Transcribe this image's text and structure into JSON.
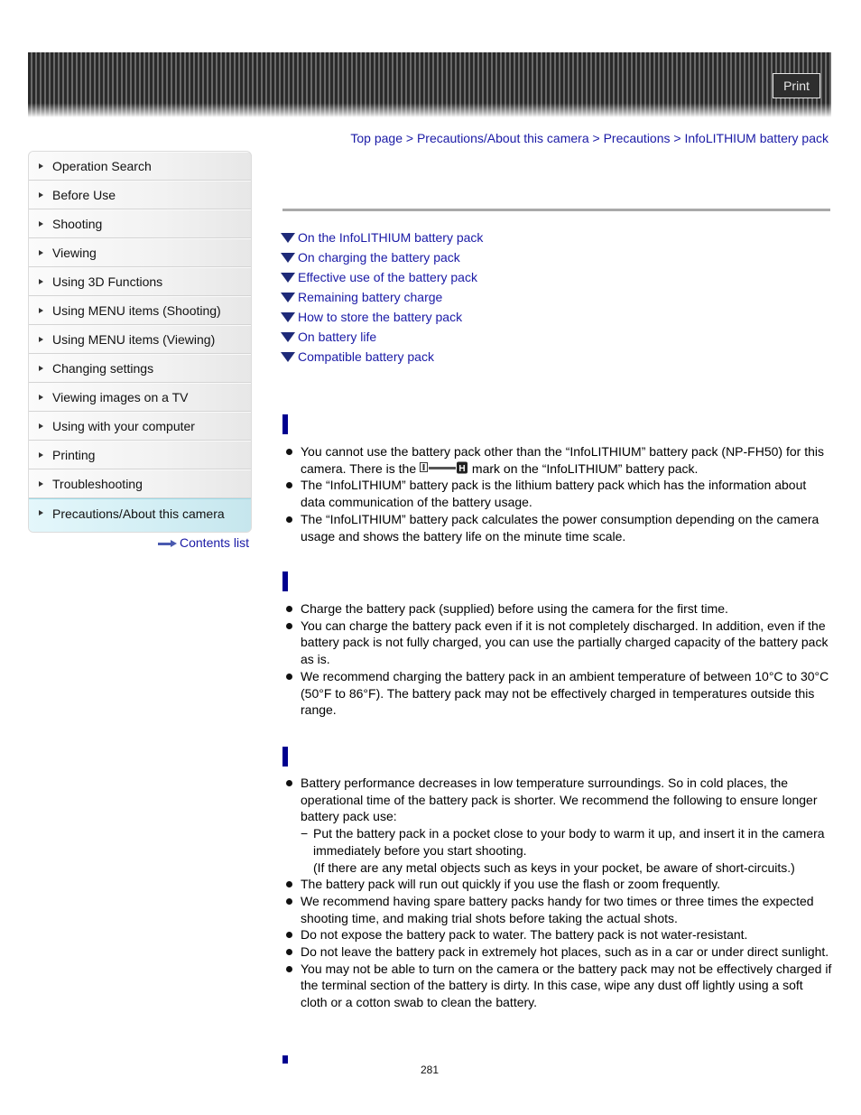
{
  "header": {
    "print_label": "Print"
  },
  "sidebar": {
    "items": [
      {
        "label": "Operation Search"
      },
      {
        "label": "Before Use"
      },
      {
        "label": "Shooting"
      },
      {
        "label": "Viewing"
      },
      {
        "label": "Using 3D Functions"
      },
      {
        "label": "Using MENU items (Shooting)"
      },
      {
        "label": "Using MENU items (Viewing)"
      },
      {
        "label": "Changing settings"
      },
      {
        "label": "Viewing images on a TV"
      },
      {
        "label": "Using with your computer"
      },
      {
        "label": "Printing"
      },
      {
        "label": "Troubleshooting"
      },
      {
        "label": "Precautions/About this camera",
        "active": true
      }
    ],
    "contents_link": "Contents list"
  },
  "breadcrumb": {
    "items": [
      "Top page",
      "Precautions/About this camera",
      "Precautions",
      "InfoLITHIUM battery pack"
    ],
    "separator": ">"
  },
  "toc": [
    "On the InfoLITHIUM battery pack",
    "On charging the battery pack",
    "Effective use of the battery pack",
    "Remaining battery charge",
    "How to store the battery pack",
    "On battery life",
    "Compatible battery pack"
  ],
  "sections": {
    "infolithium": {
      "b1_pre": "You cannot use the battery pack other than the “InfoLITHIUM” battery pack (NP-FH50) for this camera. There is the ",
      "b1_icon": "infolithium-h-mark-icon",
      "b1_post": " mark on the “InfoLITHIUM” battery pack.",
      "b2": "The “InfoLITHIUM” battery pack is the lithium battery pack which has the information about data communication of the battery usage.",
      "b3": "The “InfoLITHIUM” battery pack calculates the power consumption depending on the camera usage and shows the battery life on the minute time scale."
    },
    "charging": {
      "b1": "Charge the battery pack (supplied) before using the camera for the first time.",
      "b2": "You can charge the battery pack even if it is not completely discharged. In addition, even if the battery pack is not fully charged, you can use the partially charged capacity of the battery pack as is.",
      "b3": "We recommend charging the battery pack in an ambient temperature of between 10°C to 30°C (50°F to 86°F). The battery pack may not be effectively charged in temperatures outside this range."
    },
    "effective_use": {
      "b1": "Battery performance decreases in low temperature surroundings. So in cold places, the operational time of the battery pack is shorter. We recommend the following to ensure longer battery pack use:",
      "b1_sub_dash": "−",
      "b1_sub": "Put the battery pack in a pocket close to your body to warm it up, and insert it in the camera immediately before you start shooting.",
      "b1_sub_note": "(If there are any metal objects such as keys in your pocket, be aware of short-circuits.)",
      "b2": "The battery pack will run out quickly if you use the flash or zoom frequently.",
      "b3": "We recommend having spare battery packs handy for two times or three times the expected shooting time, and making trial shots before taking the actual shots.",
      "b4": "Do not expose the battery pack to water. The battery pack is not water-resistant.",
      "b5": "Do not leave the battery pack in extremely hot places, such as in a car or under direct sunlight.",
      "b6": "You may not be able to turn on the camera or the battery pack may not be effectively charged if the terminal section of the battery is dirty. In this case, wipe any dust off lightly using a soft cloth or a cotton swab to clean the battery."
    }
  },
  "page_number": "281"
}
